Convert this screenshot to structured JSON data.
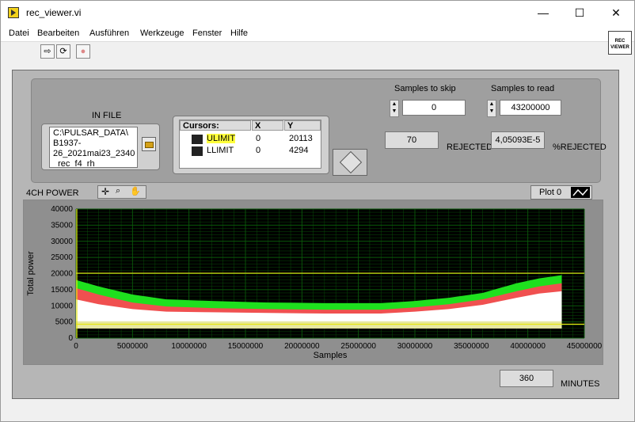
{
  "window": {
    "title": "rec_viewer.vi",
    "controls": {
      "minimize": "—",
      "maximize": "☐",
      "close": "✕"
    }
  },
  "menu": [
    "Datei",
    "Bearbeiten",
    "Ausführen",
    "Werkzeuge",
    "Fenster",
    "Hilfe"
  ],
  "toolbar": {
    "run": "⇨",
    "run_continuous": "⟳",
    "abort": "●"
  },
  "vi_icon": {
    "line1": "REC",
    "line2": "VIEWER"
  },
  "in_file": {
    "label": "IN FILE",
    "path_line1": "C:\\PULSAR_DATA\\",
    "path_line2": "B1937-",
    "path_line3": "26_2021mai23_2340",
    "path_line4": "_rec_f4_rh"
  },
  "cursors": {
    "header": "Cursors:",
    "col_x": "X",
    "col_y": "Y",
    "rows": [
      {
        "name": "ULIMIT",
        "x": "0",
        "y": "20113"
      },
      {
        "name": "LLIMIT",
        "x": "0",
        "y": "4294"
      }
    ]
  },
  "samples_to_skip": {
    "label": "Samples to skip",
    "value": "0"
  },
  "samples_to_read": {
    "label": "Samples to read",
    "value": "43200000"
  },
  "rejected": {
    "value": "70",
    "label": "REJECTED"
  },
  "percent_rejected": {
    "value": "4,05093E-5",
    "label": "%REJECTED"
  },
  "graph": {
    "title": "4CH POWER",
    "legend": "Plot 0"
  },
  "minutes": {
    "value": "360",
    "label": "MINUTES"
  },
  "colors": {
    "plot_bg": "#000000",
    "grid": "#0a5a0a",
    "limit_line": "#e6e610",
    "green": "#1ee01e",
    "red": "#f05050",
    "white": "#ffffff"
  },
  "chart_data": {
    "type": "line",
    "xlabel": "Samples",
    "ylabel": "Total power",
    "xlim": [
      0,
      45000000
    ],
    "ylim": [
      0,
      40000
    ],
    "x_ticks": [
      0,
      5000000,
      10000000,
      15000000,
      20000000,
      25000000,
      30000000,
      35000000,
      40000000,
      45000000
    ],
    "y_ticks": [
      0,
      5000,
      10000,
      15000,
      20000,
      25000,
      30000,
      35000,
      40000
    ],
    "limits": {
      "ULIMIT": 20113,
      "LLIMIT": 4294
    },
    "series": [
      {
        "color": "#1ee01e",
        "x": [
          0,
          2000000,
          5000000,
          8000000,
          12000000,
          17000000,
          22000000,
          27000000,
          30000000,
          33000000,
          36000000,
          39000000,
          41000000,
          43000000
        ],
        "values": [
          18000,
          16000,
          13500,
          12000,
          11500,
          11000,
          10800,
          10800,
          11500,
          12500,
          14000,
          17000,
          18500,
          19500
        ]
      },
      {
        "color": "#f05050",
        "x": [
          0,
          2000000,
          5000000,
          8000000,
          12000000,
          17000000,
          22000000,
          27000000,
          30000000,
          33000000,
          36000000,
          39000000,
          41000000,
          43000000
        ],
        "values": [
          15500,
          13500,
          11000,
          9800,
          9300,
          9000,
          8800,
          8800,
          9500,
          10500,
          12000,
          14500,
          16000,
          17000
        ]
      },
      {
        "color": "#ffffff",
        "x": [
          0,
          2000000,
          5000000,
          8000000,
          12000000,
          17000000,
          22000000,
          27000000,
          30000000,
          33000000,
          36000000,
          39000000,
          41000000,
          43000000
        ],
        "values": [
          12000,
          10500,
          9000,
          8200,
          8000,
          7800,
          7600,
          7600,
          8200,
          9000,
          10300,
          12500,
          13800,
          14500
        ]
      }
    ]
  }
}
